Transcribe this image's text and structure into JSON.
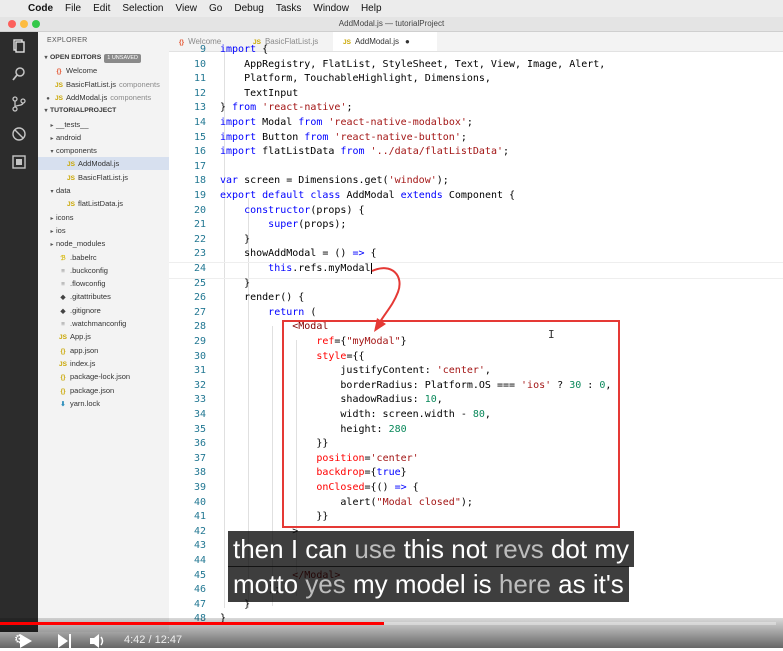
{
  "menubar": {
    "apple": "",
    "items": [
      "Code",
      "File",
      "Edit",
      "Selection",
      "View",
      "Go",
      "Debug",
      "Tasks",
      "Window",
      "Help"
    ]
  },
  "window": {
    "title": "AddModal.js — tutorialProject"
  },
  "sidebar": {
    "title": "EXPLORER",
    "open_editors": {
      "label": "OPEN EDITORS",
      "badge": "1 UNSAVED"
    },
    "open_files": [
      {
        "icon": "{}",
        "name": "Welcome",
        "dim": "",
        "icon_color": "#e44d26"
      },
      {
        "icon": "JS",
        "name": "BasicFlatList.js",
        "dim": "components",
        "icon_color": "#c9a600"
      },
      {
        "icon": "JS",
        "name": "AddModal.js",
        "dim": "components",
        "icon_color": "#c9a600",
        "selected": true
      }
    ],
    "project": {
      "label": "TUTORIALPROJECT"
    },
    "tree": [
      {
        "twisty": "▸",
        "icon": "",
        "name": "__tests__",
        "indent": 1
      },
      {
        "twisty": "▸",
        "icon": "",
        "name": "android",
        "indent": 1
      },
      {
        "twisty": "▾",
        "icon": "",
        "name": "components",
        "indent": 1
      },
      {
        "twisty": "",
        "icon": "JS",
        "name": "AddModal.js",
        "indent": 2,
        "selected": true,
        "icon_color": "#c9a600"
      },
      {
        "twisty": "",
        "icon": "JS",
        "name": "BasicFlatList.js",
        "indent": 2,
        "icon_color": "#c9a600"
      },
      {
        "twisty": "▾",
        "icon": "",
        "name": "data",
        "indent": 1
      },
      {
        "twisty": "",
        "icon": "JS",
        "name": "flatListData.js",
        "indent": 2,
        "icon_color": "#c9a600"
      },
      {
        "twisty": "▸",
        "icon": "",
        "name": "icons",
        "indent": 1
      },
      {
        "twisty": "▸",
        "icon": "",
        "name": "ios",
        "indent": 1
      },
      {
        "twisty": "▸",
        "icon": "",
        "name": "node_modules",
        "indent": 1
      },
      {
        "twisty": "",
        "icon": "ℬ",
        "name": ".babelrc",
        "indent": 1,
        "icon_color": "#d4b500"
      },
      {
        "twisty": "",
        "icon": "≡",
        "name": ".buckconfig",
        "indent": 1,
        "icon_color": "#8a8a8a"
      },
      {
        "twisty": "",
        "icon": "≡",
        "name": ".flowconfig",
        "indent": 1,
        "icon_color": "#8a8a8a"
      },
      {
        "twisty": "",
        "icon": "◆",
        "name": ".gitattributes",
        "indent": 1,
        "icon_color": "#444444"
      },
      {
        "twisty": "",
        "icon": "◆",
        "name": ".gitignore",
        "indent": 1,
        "icon_color": "#444444"
      },
      {
        "twisty": "",
        "icon": "≡",
        "name": ".watchmanconfig",
        "indent": 1,
        "icon_color": "#8a8a8a"
      },
      {
        "twisty": "",
        "icon": "JS",
        "name": "App.js",
        "indent": 1,
        "icon_color": "#c9a600"
      },
      {
        "twisty": "",
        "icon": "{}",
        "name": "app.json",
        "indent": 1,
        "icon_color": "#c9a600"
      },
      {
        "twisty": "",
        "icon": "JS",
        "name": "index.js",
        "indent": 1,
        "icon_color": "#c9a600"
      },
      {
        "twisty": "",
        "icon": "{}",
        "name": "package-lock.json",
        "indent": 1,
        "icon_color": "#c9a600"
      },
      {
        "twisty": "",
        "icon": "{}",
        "name": "package.json",
        "indent": 1,
        "icon_color": "#c9a600"
      },
      {
        "twisty": "",
        "icon": "⬇",
        "name": "yarn.lock",
        "indent": 1,
        "icon_color": "#2c8ebb"
      }
    ]
  },
  "tabs": [
    {
      "icon": "{}",
      "label": "Welcome",
      "active": false,
      "icon_color": "#e44d26"
    },
    {
      "icon": "JS",
      "label": "BasicFlatList.js",
      "active": false,
      "icon_color": "#c9a600"
    },
    {
      "icon": "JS",
      "label": "AddModal.js",
      "active": true,
      "dirty": "●",
      "icon_color": "#c9a600"
    }
  ],
  "code": [
    {
      "n": "9",
      "t": [
        [
          "kw",
          "import"
        ],
        [
          "plain",
          " {"
        ]
      ]
    },
    {
      "n": "10",
      "t": [
        [
          "plain",
          "    AppRegistry, FlatList, StyleSheet, Text, View, Image, Alert,"
        ]
      ]
    },
    {
      "n": "11",
      "t": [
        [
          "plain",
          "    Platform, TouchableHighlight, Dimensions,"
        ]
      ]
    },
    {
      "n": "12",
      "t": [
        [
          "plain",
          "    TextInput"
        ]
      ]
    },
    {
      "n": "13",
      "t": [
        [
          "plain",
          "} "
        ],
        [
          "kw",
          "from"
        ],
        [
          "plain",
          " "
        ],
        [
          "str",
          "'react-native'"
        ],
        [
          "plain",
          ";"
        ]
      ]
    },
    {
      "n": "14",
      "t": [
        [
          "kw",
          "import"
        ],
        [
          "plain",
          " Modal "
        ],
        [
          "kw",
          "from"
        ],
        [
          "plain",
          " "
        ],
        [
          "str",
          "'react-native-modalbox'"
        ],
        [
          "plain",
          ";"
        ]
      ]
    },
    {
      "n": "15",
      "t": [
        [
          "kw",
          "import"
        ],
        [
          "plain",
          " Button "
        ],
        [
          "kw",
          "from"
        ],
        [
          "plain",
          " "
        ],
        [
          "str",
          "'react-native-button'"
        ],
        [
          "plain",
          ";"
        ]
      ]
    },
    {
      "n": "16",
      "t": [
        [
          "kw",
          "import"
        ],
        [
          "plain",
          " flatListData "
        ],
        [
          "kw",
          "from"
        ],
        [
          "plain",
          " "
        ],
        [
          "str",
          "'../data/flatListData'"
        ],
        [
          "plain",
          ";"
        ]
      ]
    },
    {
      "n": "17",
      "t": []
    },
    {
      "n": "18",
      "t": [
        [
          "kw",
          "var"
        ],
        [
          "plain",
          " screen = Dimensions.get("
        ],
        [
          "str",
          "'window'"
        ],
        [
          "plain",
          ");"
        ]
      ]
    },
    {
      "n": "19",
      "t": [
        [
          "kw",
          "export"
        ],
        [
          "plain",
          " "
        ],
        [
          "kw",
          "default"
        ],
        [
          "plain",
          " "
        ],
        [
          "kw",
          "class"
        ],
        [
          "plain",
          " AddModal "
        ],
        [
          "kw",
          "extends"
        ],
        [
          "plain",
          " Component {"
        ]
      ]
    },
    {
      "n": "20",
      "t": [
        [
          "plain",
          "    "
        ],
        [
          "kw",
          "constructor"
        ],
        [
          "plain",
          "(props) {"
        ]
      ]
    },
    {
      "n": "21",
      "t": [
        [
          "plain",
          "        "
        ],
        [
          "kw",
          "super"
        ],
        [
          "plain",
          "(props);"
        ]
      ]
    },
    {
      "n": "22",
      "t": [
        [
          "plain",
          "    }"
        ]
      ]
    },
    {
      "n": "23",
      "t": [
        [
          "plain",
          "    showAddModal = () "
        ],
        [
          "kw",
          "=>"
        ],
        [
          "plain",
          " {"
        ]
      ]
    },
    {
      "n": "24",
      "t": [
        [
          "plain",
          "        "
        ],
        [
          "kw",
          "this"
        ],
        [
          "plain",
          ".refs.myModal"
        ]
      ],
      "caret": true
    },
    {
      "n": "25",
      "t": [
        [
          "plain",
          "    }"
        ]
      ]
    },
    {
      "n": "26",
      "t": [
        [
          "plain",
          "    render() {"
        ]
      ]
    },
    {
      "n": "27",
      "t": [
        [
          "plain",
          "        "
        ],
        [
          "kw",
          "return"
        ],
        [
          "plain",
          " ("
        ]
      ]
    },
    {
      "n": "28",
      "t": [
        [
          "plain",
          "            "
        ],
        [
          "tag",
          "<Modal"
        ]
      ]
    },
    {
      "n": "29",
      "t": [
        [
          "plain",
          "                "
        ],
        [
          "attr",
          "ref"
        ],
        [
          "plain",
          "={"
        ],
        [
          "str",
          "\"myModal\""
        ],
        [
          "plain",
          "}"
        ]
      ]
    },
    {
      "n": "30",
      "t": [
        [
          "plain",
          "                "
        ],
        [
          "attr",
          "style"
        ],
        [
          "plain",
          "={{"
        ]
      ]
    },
    {
      "n": "31",
      "t": [
        [
          "plain",
          "                    justifyContent: "
        ],
        [
          "str",
          "'center'"
        ],
        [
          "plain",
          ","
        ]
      ]
    },
    {
      "n": "32",
      "t": [
        [
          "plain",
          "                    borderRadius: Platform.OS === "
        ],
        [
          "str",
          "'ios'"
        ],
        [
          "plain",
          " ? "
        ],
        [
          "num",
          "30"
        ],
        [
          "plain",
          " : "
        ],
        [
          "num",
          "0"
        ],
        [
          "plain",
          ","
        ]
      ]
    },
    {
      "n": "33",
      "t": [
        [
          "plain",
          "                    shadowRadius: "
        ],
        [
          "num",
          "10"
        ],
        [
          "plain",
          ","
        ]
      ]
    },
    {
      "n": "34",
      "t": [
        [
          "plain",
          "                    width: screen.width - "
        ],
        [
          "num",
          "80"
        ],
        [
          "plain",
          ","
        ]
      ]
    },
    {
      "n": "35",
      "t": [
        [
          "plain",
          "                    height: "
        ],
        [
          "num",
          "280"
        ]
      ]
    },
    {
      "n": "36",
      "t": [
        [
          "plain",
          "                }}"
        ]
      ]
    },
    {
      "n": "37",
      "t": [
        [
          "plain",
          "                "
        ],
        [
          "attr",
          "position"
        ],
        [
          "plain",
          "="
        ],
        [
          "str",
          "'center'"
        ]
      ]
    },
    {
      "n": "38",
      "t": [
        [
          "plain",
          "                "
        ],
        [
          "attr",
          "backdrop"
        ],
        [
          "plain",
          "={"
        ],
        [
          "kw",
          "true"
        ],
        [
          "plain",
          "}"
        ]
      ]
    },
    {
      "n": "39",
      "t": [
        [
          "plain",
          "                "
        ],
        [
          "attr",
          "onClosed"
        ],
        [
          "plain",
          "={() "
        ],
        [
          "kw",
          "=>"
        ],
        [
          "plain",
          " {"
        ]
      ]
    },
    {
      "n": "40",
      "t": [
        [
          "plain",
          "                    alert("
        ],
        [
          "str",
          "\"Modal closed\""
        ],
        [
          "plain",
          ");"
        ]
      ]
    },
    {
      "n": "41",
      "t": [
        [
          "plain",
          "                }}"
        ]
      ]
    },
    {
      "n": "42",
      "t": [
        [
          "plain",
          "            >"
        ]
      ]
    },
    {
      "n": "43",
      "t": []
    },
    {
      "n": "44",
      "t": []
    },
    {
      "n": "45",
      "t": [
        [
          "plain",
          "            "
        ],
        [
          "tag",
          "</Modal>"
        ]
      ]
    },
    {
      "n": "46",
      "t": [
        [
          "plain",
          "        );"
        ]
      ]
    },
    {
      "n": "47",
      "t": [
        [
          "plain",
          "    }"
        ]
      ]
    },
    {
      "n": "48",
      "t": [
        [
          "plain",
          "}"
        ]
      ]
    }
  ],
  "caption": {
    "line1": [
      [
        "then I can ",
        ""
      ],
      [
        "use",
        "dim"
      ],
      [
        " this not ",
        ""
      ],
      [
        "revs",
        "dim"
      ],
      [
        " dot my",
        ""
      ]
    ],
    "line2": [
      [
        "motto ",
        ""
      ],
      [
        "yes",
        "dim"
      ],
      [
        " my model is ",
        ""
      ],
      [
        "here",
        "dim"
      ],
      [
        " as it's",
        ""
      ]
    ]
  },
  "player": {
    "time": "4:42 / 12:47",
    "progress": 0.5
  },
  "colors": {
    "accent_red": "#e53935",
    "youtube_red": "#ff0000"
  }
}
